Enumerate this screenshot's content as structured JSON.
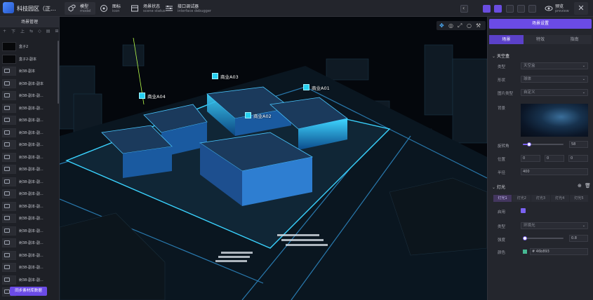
{
  "header": {
    "title": "科技园区（正...",
    "tools": [
      {
        "cn": "模型",
        "en": "model",
        "icon": "cubes-icon"
      },
      {
        "cn": "图标",
        "en": "icon",
        "icon": "target-icon"
      },
      {
        "cn": "场景状态",
        "en": "scene status",
        "icon": "scene-icon"
      },
      {
        "cn": "接口调试器",
        "en": "interface debugger",
        "icon": "sliders-icon"
      }
    ],
    "preview": {
      "cn": "预览",
      "en": "preview"
    },
    "colors": {
      "accent": "#6b4be6",
      "bg": "#1b1c22"
    }
  },
  "left": {
    "title": "场景管理",
    "tools": [
      "+",
      "下",
      "上",
      "⇆",
      "◇",
      "▤",
      "⊞",
      "≡",
      "⊘"
    ],
    "items": [
      {
        "label": "盒子2",
        "thumb": "dark"
      },
      {
        "label": "盒子2-副本",
        "thumb": "dark"
      },
      {
        "label": "树38-副本",
        "thumb": "image"
      },
      {
        "label": "树38-副本-副本",
        "thumb": "image"
      },
      {
        "label": "树38-副本-副...",
        "thumb": "image"
      },
      {
        "label": "树38-副本-副...",
        "thumb": "image"
      },
      {
        "label": "树38-副本-副...",
        "thumb": "image"
      },
      {
        "label": "树38-副本-副...",
        "thumb": "image"
      },
      {
        "label": "树38-副本-副...",
        "thumb": "image"
      },
      {
        "label": "树38-副本-副...",
        "thumb": "image"
      },
      {
        "label": "树38-副本-副...",
        "thumb": "image"
      },
      {
        "label": "树38-副本-副...",
        "thumb": "image"
      },
      {
        "label": "树38-副本-副...",
        "thumb": "image"
      },
      {
        "label": "树38-副本-副...",
        "thumb": "image"
      },
      {
        "label": "树38-副本-副...",
        "thumb": "image"
      },
      {
        "label": "树38-副本-副...",
        "thumb": "image"
      },
      {
        "label": "树38-副本-副...",
        "thumb": "image"
      },
      {
        "label": "树38-副本-副...",
        "thumb": "image"
      },
      {
        "label": "树38-副本-副...",
        "thumb": "image"
      },
      {
        "label": "树38-副本-副...",
        "thumb": "image"
      },
      {
        "label": "树38-副本-副...",
        "thumb": "image"
      }
    ],
    "sync_button": "同步素材库数据"
  },
  "viewport": {
    "tags": [
      {
        "label": "商业A03"
      },
      {
        "label": "商业A01"
      },
      {
        "label": "商业A04"
      },
      {
        "label": "商业A02"
      }
    ]
  },
  "right": {
    "scene_settings": "场景设置",
    "tabs": [
      "场景",
      "特效",
      "指南"
    ],
    "skybox": {
      "section": "天空盒",
      "type_label": "类型",
      "type_value": "天空盒",
      "shape_label": "形状",
      "shape_value": "球体",
      "image_type_label": "图片类型",
      "image_type_value": "自定义",
      "background_label": "背景",
      "rotation_label": "旋转角",
      "rotation_value": "58",
      "position_label": "位置",
      "position": [
        "0",
        "0",
        "0"
      ],
      "radius_label": "半径",
      "radius_value": "400"
    },
    "lights": {
      "section": "灯光",
      "tabs": [
        "灯光1",
        "灯光2",
        "灯光3",
        "灯光4",
        "灯光5"
      ],
      "enabled_label": "启用",
      "type_label": "类型",
      "type_value": "环境光",
      "intensity_label": "强度",
      "intensity_value": "0.8",
      "color_label": "颜色",
      "color_value": "46b893"
    }
  }
}
